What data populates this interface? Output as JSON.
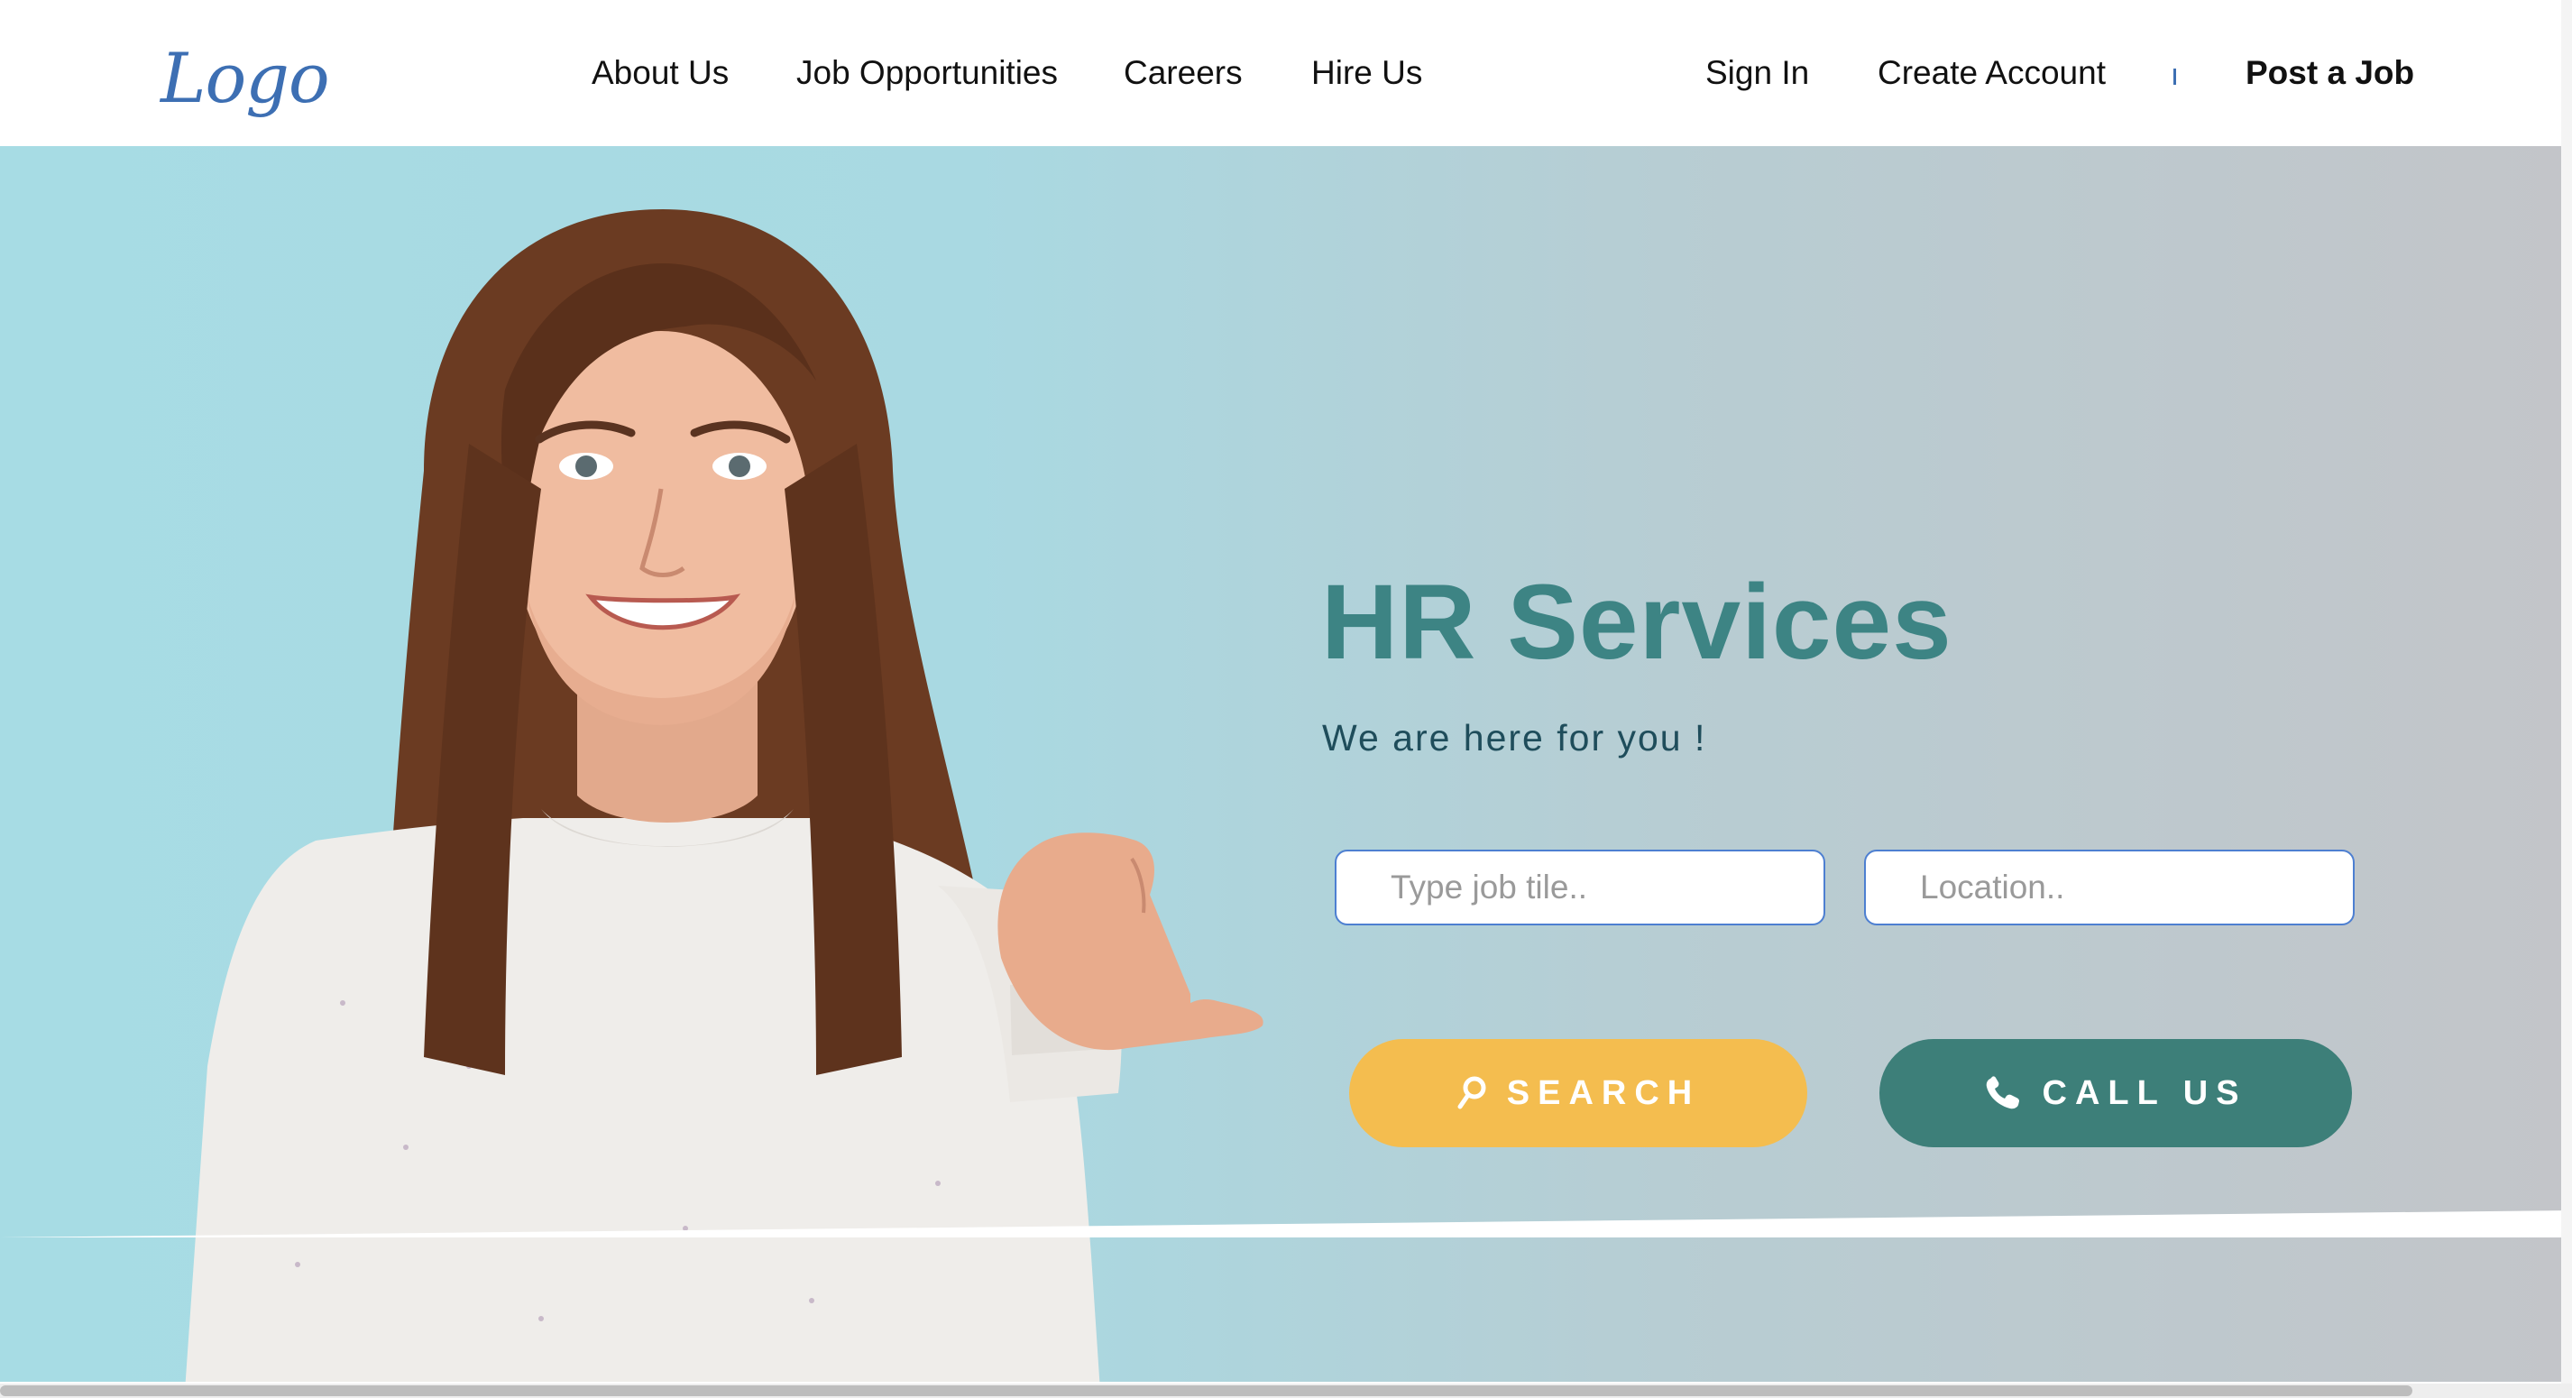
{
  "header": {
    "logo_text": "Logo",
    "nav": [
      {
        "label": "About Us"
      },
      {
        "label": "Job Opportunities"
      },
      {
        "label": "Careers"
      },
      {
        "label": "Hire Us"
      }
    ],
    "account": {
      "sign_in": "Sign In",
      "create_account": "Create Account",
      "post_job": "Post a Job"
    }
  },
  "hero": {
    "title": "HR Services",
    "subtitle": "We are here for you !",
    "search": {
      "job_placeholder": "Type job tile..",
      "location_placeholder": "Location..",
      "job_value": "",
      "location_value": ""
    },
    "buttons": {
      "search_label": "SEARCH",
      "search_icon": "magnifier-icon",
      "call_label": "CALL US",
      "call_icon": "phone-icon"
    },
    "image": "smiling-woman-pointing-thumb-photo"
  },
  "colors": {
    "accent_teal": "#3d8484",
    "button_search": "#f4bd4f",
    "button_call": "#3d7f79",
    "logo_blue": "#3d6fb3",
    "subtitle": "#1f4d5b"
  }
}
